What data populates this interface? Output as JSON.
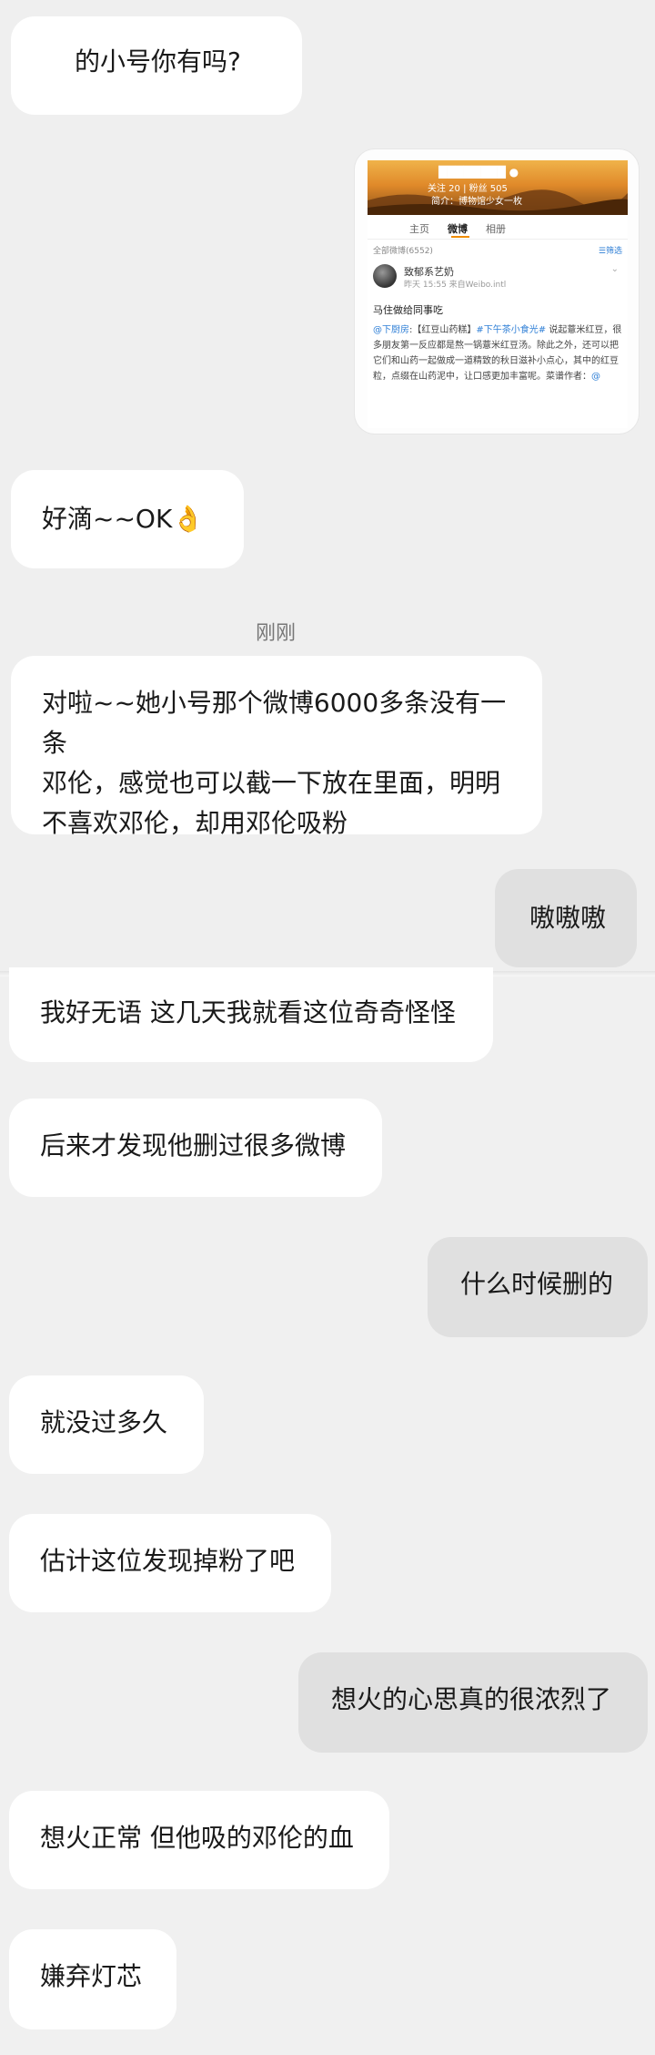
{
  "messages": [
    {
      "side": "in",
      "text": "的小号你有吗?"
    },
    {
      "side": "in",
      "text": "好滴~~OK👌"
    },
    {
      "side": "in",
      "text": "对啦~~她小号那个微博6000多条没有一条\n邓伦，感觉也可以截一下放在里面，明明\n不喜欢邓伦，却用邓伦吸粉"
    },
    {
      "side": "out",
      "text": "嗷嗷嗷"
    },
    {
      "side": "in",
      "text": "我好无语 这几天我就看这位奇奇怪怪"
    },
    {
      "side": "in",
      "text": "后来才发现他删过很多微博"
    },
    {
      "side": "out",
      "text": "什么时候删的"
    },
    {
      "side": "in",
      "text": "就没过多久"
    },
    {
      "side": "in",
      "text": "估计这位发现掉粉了吧"
    },
    {
      "side": "out",
      "text": "想火的心思真的很浓烈了"
    },
    {
      "side": "in",
      "text": "想火正常 但他吸的邓伦的血"
    },
    {
      "side": "in",
      "text": "嫌弃灯芯"
    }
  ],
  "timestamp": "刚刚",
  "embedded_screenshot": {
    "profile_stats": "关注 20 | 粉丝 505",
    "profile_intro": "简介：博物馆少女一枚",
    "tabs": [
      "主页",
      "微博",
      "相册"
    ],
    "active_tab": "微博",
    "all_posts": "全部微博(6552)",
    "filter": "☰筛选",
    "poster": "致郁系艺奶",
    "post_meta": "昨天 15:55  来自Weibo.intl",
    "post_title": "马住做给同事吃",
    "post_body_tag1": "@下厨房",
    "post_body_1": ":【红豆山药糕】",
    "post_body_tag2": "#下午茶小食光#",
    "post_body_2": " 说起薏米红豆，很多朋友第一反应都是熬一锅薏米红豆汤。除此之外，还可以把它们和山药一起做成一道精致的秋日滋补小点心，其中的红豆粒，点缀在山药泥中，让口感更加丰富呢。菜谱作者：",
    "post_body_tag3": "@"
  },
  "colors": {
    "background": "#efefef",
    "bubble_in": "#ffffff",
    "bubble_out": "#e0e0e0",
    "accent": "#f08c00",
    "link": "#2f7fd6"
  }
}
